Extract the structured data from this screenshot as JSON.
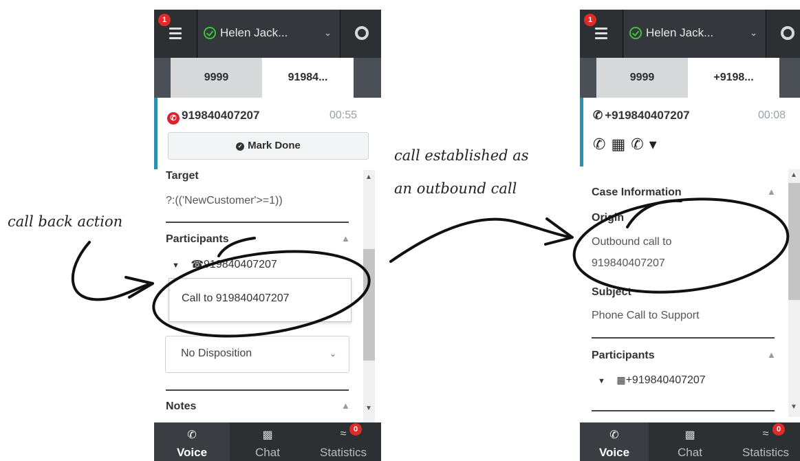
{
  "annotations": {
    "left": "call back action",
    "middle_line1": "call established as",
    "middle_line2": "an outbound call"
  },
  "panel_a": {
    "menu_badge": "1",
    "agent_name": "Helen Jack...",
    "tabs": [
      "9999",
      "91984..."
    ],
    "call": {
      "number": "919840407207",
      "duration": "00:55",
      "status_icon": "call-dropped-icon"
    },
    "mark_done_label": "Mark Done",
    "target": {
      "label": "Target",
      "value": "?:(('NewCustomer'>=1))"
    },
    "participants": {
      "label": "Participants",
      "number": "919840407207"
    },
    "popup_item": "Call to 919840407207",
    "disposition": "No Disposition",
    "notes_label": "Notes",
    "bottom": [
      {
        "label": "Voice",
        "icon": "phone-icon"
      },
      {
        "label": "Chat",
        "icon": "chat-icon"
      },
      {
        "label": "Statistics",
        "icon": "statistics-icon",
        "badge": "0"
      }
    ]
  },
  "panel_b": {
    "menu_badge": "1",
    "agent_name": "Helen Jack...",
    "tabs": [
      "9999",
      "+9198..."
    ],
    "call": {
      "number": "+919840407207",
      "duration": "00:08",
      "status_icon": "outbound-call-icon"
    },
    "case_info": {
      "label": "Case Information",
      "origin_label": "Origin",
      "origin_value_1": "Outbound call to",
      "origin_value_2": "919840407207",
      "subject_label": "Subject",
      "subject_value": "Phone Call to Support"
    },
    "participants": {
      "label": "Participants",
      "number": "+919840407207"
    },
    "bottom": [
      {
        "label": "Voice",
        "icon": "phone-icon"
      },
      {
        "label": "Chat",
        "icon": "chat-icon"
      },
      {
        "label": "Statistics",
        "icon": "statistics-icon",
        "badge": "0"
      }
    ]
  }
}
